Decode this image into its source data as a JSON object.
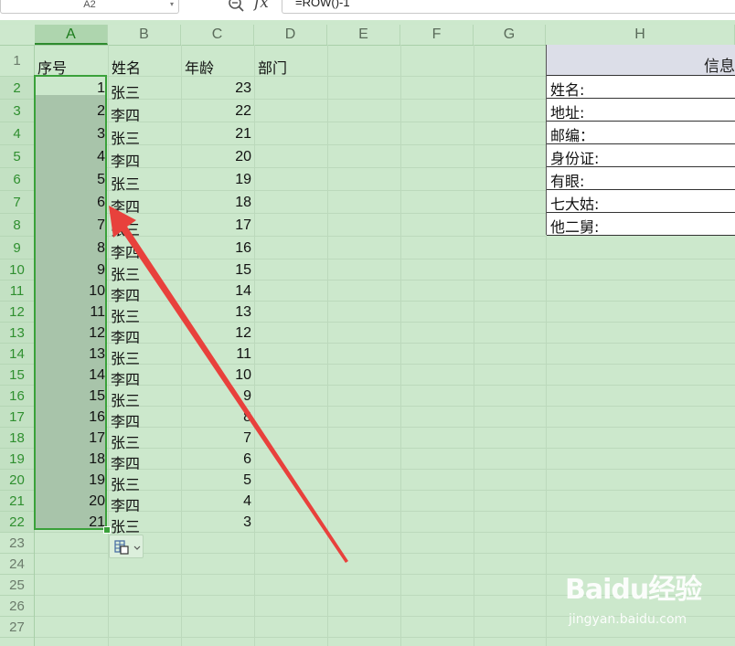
{
  "formula_bar": {
    "name_box": "A2",
    "fx": "fx",
    "formula": "=ROW()-1"
  },
  "columns": [
    "A",
    "B",
    "C",
    "D",
    "E",
    "F",
    "G",
    "H"
  ],
  "rows": [
    "1",
    "2",
    "3",
    "4",
    "5",
    "6",
    "7",
    "8",
    "9",
    "10",
    "11",
    "12",
    "13",
    "14",
    "15",
    "16",
    "17",
    "18",
    "19",
    "20",
    "21",
    "22",
    "23",
    "24",
    "25",
    "26",
    "27"
  ],
  "header": {
    "a": "序号",
    "b": "姓名",
    "c": "年龄",
    "d": "部门"
  },
  "data_rows": [
    {
      "seq": "1",
      "name": "张三",
      "age": "23"
    },
    {
      "seq": "2",
      "name": "李四",
      "age": "22"
    },
    {
      "seq": "3",
      "name": "张三",
      "age": "21"
    },
    {
      "seq": "4",
      "name": "李四",
      "age": "20"
    },
    {
      "seq": "5",
      "name": "张三",
      "age": "19"
    },
    {
      "seq": "6",
      "name": "李四",
      "age": "18"
    },
    {
      "seq": "7",
      "name": "张三",
      "age": "17"
    },
    {
      "seq": "8",
      "name": "李四",
      "age": "16"
    },
    {
      "seq": "9",
      "name": "张三",
      "age": "15"
    },
    {
      "seq": "10",
      "name": "李四",
      "age": "14"
    },
    {
      "seq": "11",
      "name": "张三",
      "age": "13"
    },
    {
      "seq": "12",
      "name": "李四",
      "age": "12"
    },
    {
      "seq": "13",
      "name": "张三",
      "age": "11"
    },
    {
      "seq": "14",
      "name": "李四",
      "age": "10"
    },
    {
      "seq": "15",
      "name": "张三",
      "age": "9"
    },
    {
      "seq": "16",
      "name": "李四",
      "age": "8"
    },
    {
      "seq": "17",
      "name": "张三",
      "age": "7"
    },
    {
      "seq": "18",
      "name": "李四",
      "age": "6"
    },
    {
      "seq": "19",
      "name": "张三",
      "age": "5"
    },
    {
      "seq": "20",
      "name": "李四",
      "age": "4"
    },
    {
      "seq": "21",
      "name": "张三",
      "age": "3"
    }
  ],
  "info_panel": {
    "title": "信息",
    "fields": [
      "姓名:",
      "地址:",
      "邮编：",
      "身份证:",
      "有眼:",
      "七大姑:",
      "他二舅:"
    ]
  },
  "paste_options_icon": "paste-options-icon",
  "watermark": {
    "logo": "Baidu经验",
    "url": "jingyan.baidu.com"
  },
  "colors": {
    "sheet_bg": "#cce8cc",
    "selection": "#3aa13a",
    "arrow": "#e8413c"
  }
}
